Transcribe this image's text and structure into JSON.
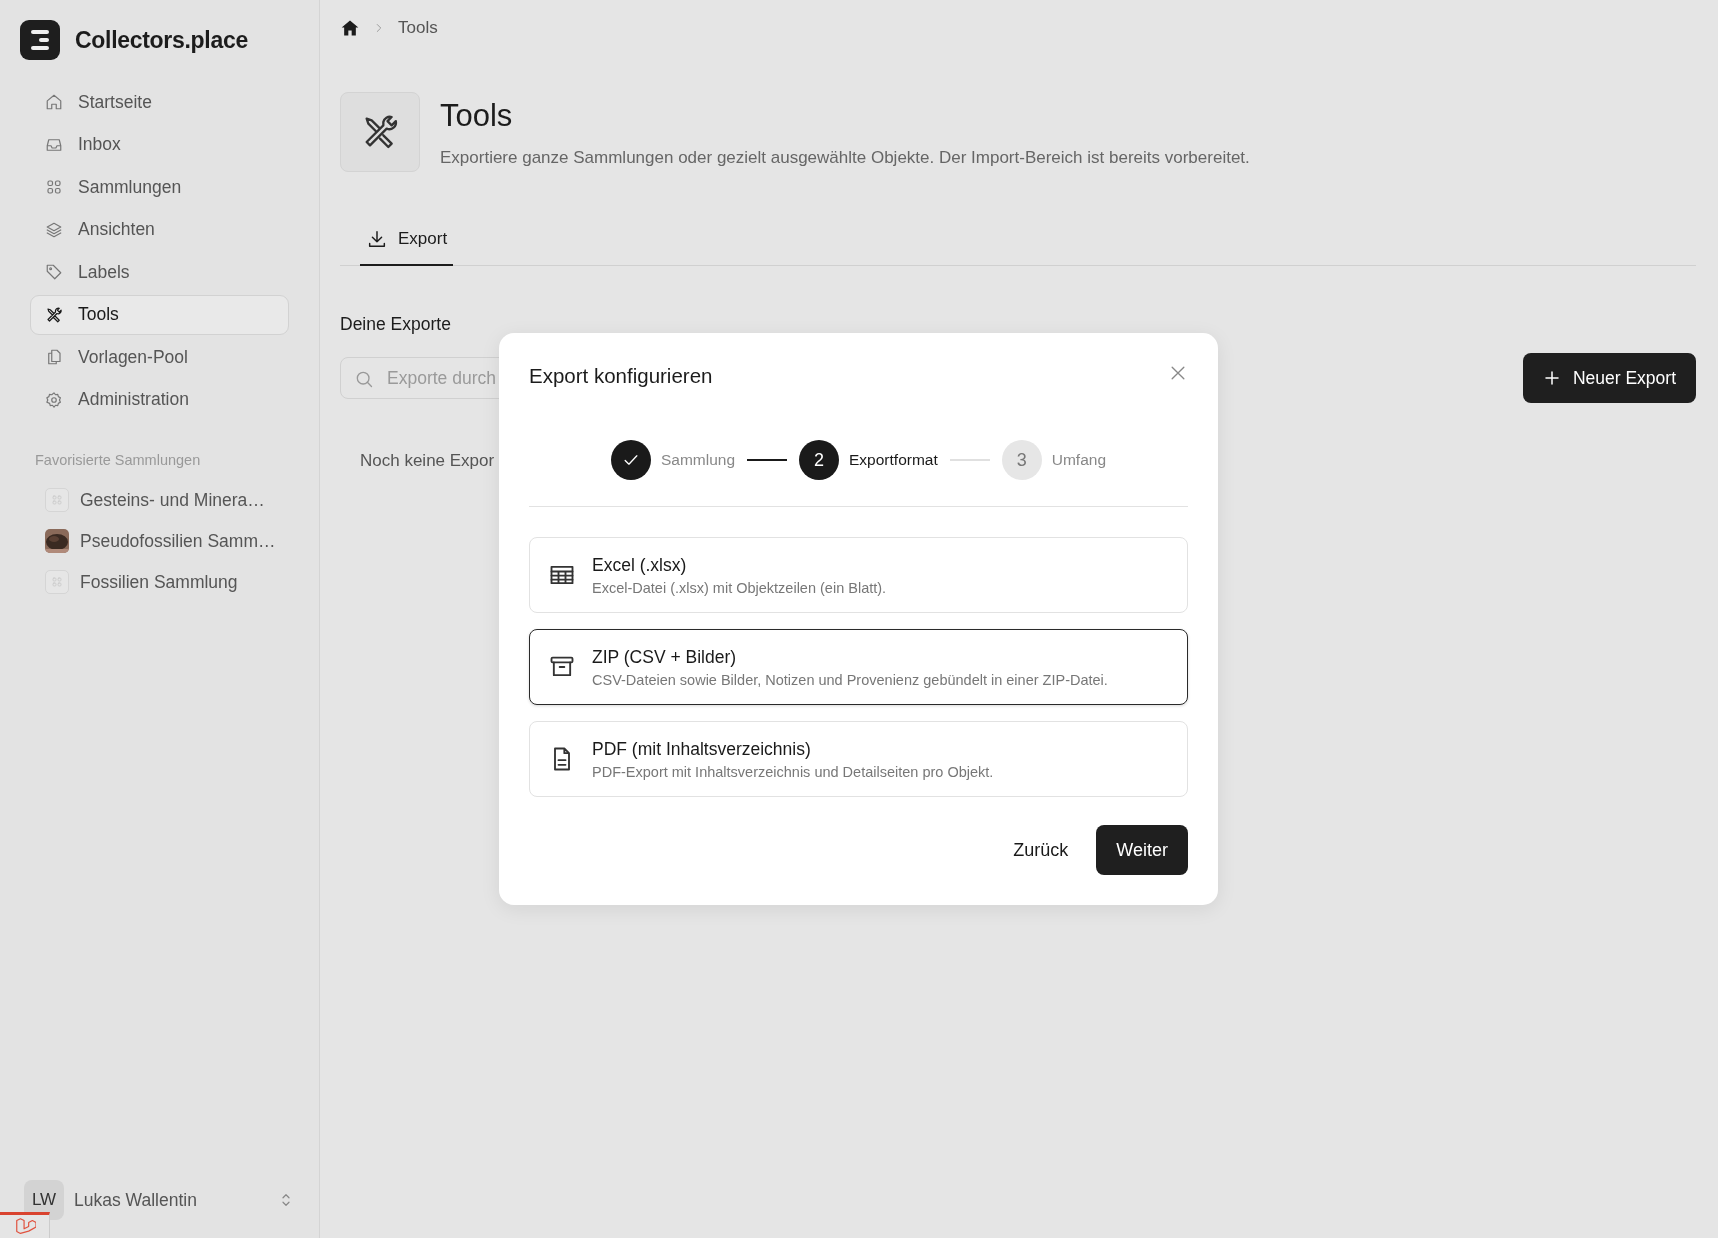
{
  "app": {
    "name": "Collectors.place"
  },
  "sidebar": {
    "items": [
      {
        "kind": "home",
        "label": "Startseite",
        "selected": false
      },
      {
        "kind": "inbox",
        "label": "Inbox",
        "selected": false
      },
      {
        "kind": "grid",
        "label": "Sammlungen",
        "selected": false
      },
      {
        "kind": "layers",
        "label": "Ansichten",
        "selected": false
      },
      {
        "kind": "tag",
        "label": "Labels",
        "selected": false
      },
      {
        "kind": "tools",
        "label": "Tools",
        "selected": true
      },
      {
        "kind": "copy",
        "label": "Vorlagen-Pool",
        "selected": false
      },
      {
        "kind": "gear",
        "label": "Administration",
        "selected": false
      }
    ],
    "favorites_heading": "Favorisierte Sammlungen",
    "favorites": [
      {
        "kind": "placeholder",
        "label": "Gesteins- und Minera…"
      },
      {
        "kind": "picture",
        "label": "Pseudofossilien Samm…"
      },
      {
        "kind": "placeholder",
        "label": "Fossilien Sammlung"
      }
    ],
    "user": {
      "initials": "LW",
      "name": "Lukas Wallentin"
    }
  },
  "breadcrumb": [
    "Tools"
  ],
  "header": {
    "title": "Tools",
    "description": "Exportiere ganze Sammlungen oder gezielt ausgewählte Objekte. Der Import-Bereich ist bereits vorbereitet."
  },
  "tabs": [
    {
      "label": "Export",
      "selected": true
    }
  ],
  "section_title": "Deine Exporte",
  "search": {
    "placeholder": "Exporte durch"
  },
  "new_button": "Neuer Export",
  "empty_text": "Noch keine Expor",
  "modal": {
    "title": "Export konfigurieren",
    "steps": [
      {
        "kind": "done",
        "label": "Sammlung"
      },
      {
        "kind": "current",
        "number": "2",
        "label": "Exportformat"
      },
      {
        "kind": "upcoming",
        "number": "3",
        "label": "Umfang"
      }
    ],
    "options": [
      {
        "kind": "table",
        "title": "Excel (.xlsx)",
        "description": "Excel-Datei (.xlsx) mit Objektzeilen (ein Blatt).",
        "selected": false
      },
      {
        "kind": "archive",
        "title": "ZIP (CSV + Bilder)",
        "description": "CSV-Dateien sowie Bilder, Notizen und Provenienz gebündelt in einer ZIP-Datei.",
        "selected": true
      },
      {
        "kind": "document",
        "title": "PDF (mit Inhaltsverzeichnis)",
        "description": "PDF-Export mit Inhaltsverzeichnis und Detailseiten pro Objekt.",
        "selected": false
      }
    ],
    "back_button": "Zurück",
    "next_button": "Weiter"
  }
}
